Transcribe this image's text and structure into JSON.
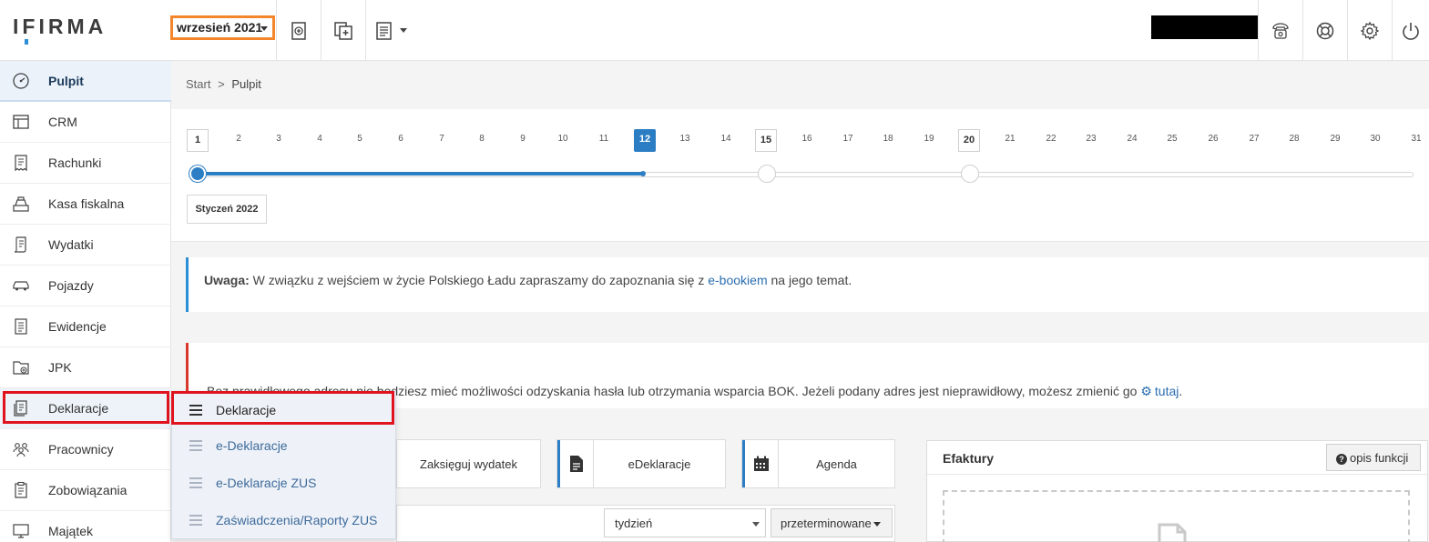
{
  "logo": {
    "text": "IFIRMA"
  },
  "header": {
    "month_selector": "wrzesień 2021",
    "toolbar_icons": [
      "new-invoice-icon",
      "add-document-icon",
      "document-list-icon"
    ],
    "right_icons": [
      "phone-icon",
      "lifebuoy-icon",
      "gear-icon",
      "power-icon"
    ]
  },
  "sidebar": {
    "items": [
      {
        "label": "Pulpit",
        "icon": "dashboard-icon"
      },
      {
        "label": "CRM",
        "icon": "crm-icon"
      },
      {
        "label": "Rachunki",
        "icon": "receipt-icon"
      },
      {
        "label": "Kasa fiskalna",
        "icon": "cash-register-icon"
      },
      {
        "label": "Wydatki",
        "icon": "expenses-icon"
      },
      {
        "label": "Pojazdy",
        "icon": "car-icon"
      },
      {
        "label": "Ewidencje",
        "icon": "records-icon"
      },
      {
        "label": "JPK",
        "icon": "jpk-icon"
      },
      {
        "label": "Deklaracje",
        "icon": "declarations-icon"
      },
      {
        "label": "Pracownicy",
        "icon": "employees-icon"
      },
      {
        "label": "Zobowiązania",
        "icon": "liabilities-icon"
      },
      {
        "label": "Majątek",
        "icon": "assets-icon"
      }
    ]
  },
  "breadcrumb": {
    "start": "Start",
    "separator": ">",
    "current": "Pulpit"
  },
  "timeline": {
    "days": [
      "1",
      "2",
      "3",
      "4",
      "5",
      "6",
      "7",
      "8",
      "9",
      "10",
      "11",
      "12",
      "13",
      "14",
      "15",
      "16",
      "17",
      "18",
      "19",
      "20",
      "21",
      "22",
      "23",
      "24",
      "25",
      "26",
      "27",
      "28",
      "29",
      "30",
      "31"
    ],
    "today": "12",
    "marked_days": [
      "1",
      "15",
      "20"
    ],
    "month_label": "Styczeń 2022"
  },
  "notice": {
    "strong": "Uwaga:",
    "text_before": " W związku z wejściem w życie Polskiego Ładu zapraszamy do zapoznania się z ",
    "link": "e-bookiem",
    "text_after": " na jego temat."
  },
  "alert": {
    "text_before": "Bez prawidłowego adresu nie będziesz mieć możliwości odzyskania hasła lub otrzymania wsparcia BOK. Jeżeli podany adres jest nieprawidłowy, możesz zmienić go ",
    "link": "tutaj",
    "text_after": "."
  },
  "quick_actions": [
    {
      "label": "Zaksięguj wydatek"
    },
    {
      "label": "eDeklaracje",
      "icon": "document-icon"
    },
    {
      "label": "Agenda",
      "icon": "calendar-icon"
    }
  ],
  "filters": {
    "period": "tydzień",
    "status": "przeterminowane"
  },
  "efaktury": {
    "title": "Efaktury",
    "help_button": "opis funkcji"
  },
  "dropdown": {
    "items": [
      {
        "label": "Deklaracje"
      },
      {
        "label": "e-Deklaracje"
      },
      {
        "label": "e-Deklaracje ZUS"
      },
      {
        "label": "Zaświadczenia/Raporty ZUS"
      }
    ]
  },
  "colors": {
    "accent": "#2c7ec4",
    "highlight_orange": "#f3852a",
    "highlight_red": "#e0141f",
    "alert_red": "#d83a2c"
  }
}
